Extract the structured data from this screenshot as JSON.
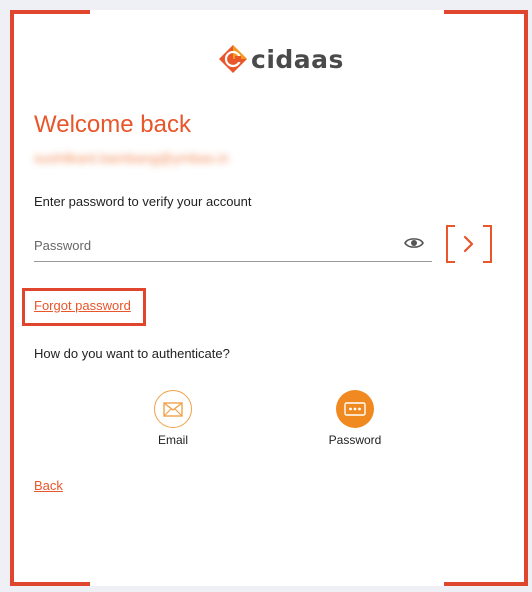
{
  "brand": {
    "name": "cidaas",
    "accent_color": "#e8562a",
    "logo_icon": "cidaas-logo-icon"
  },
  "login": {
    "title": "Welcome back",
    "email_masked": "sushilkant.bambang@ymbas.in",
    "prompt": "Enter password to verify your account",
    "password": {
      "value": "",
      "placeholder": "Password",
      "toggle_icon": "eye-icon"
    },
    "submit_icon": "chevron-right-icon",
    "forgot_label": "Forgot password",
    "auth_question": "How do you want to authenticate?",
    "methods": [
      {
        "label": "Email",
        "icon": "envelope-icon",
        "selected": false
      },
      {
        "label": "Password",
        "icon": "password-dots-icon",
        "selected": true
      }
    ],
    "back_label": "Back"
  }
}
